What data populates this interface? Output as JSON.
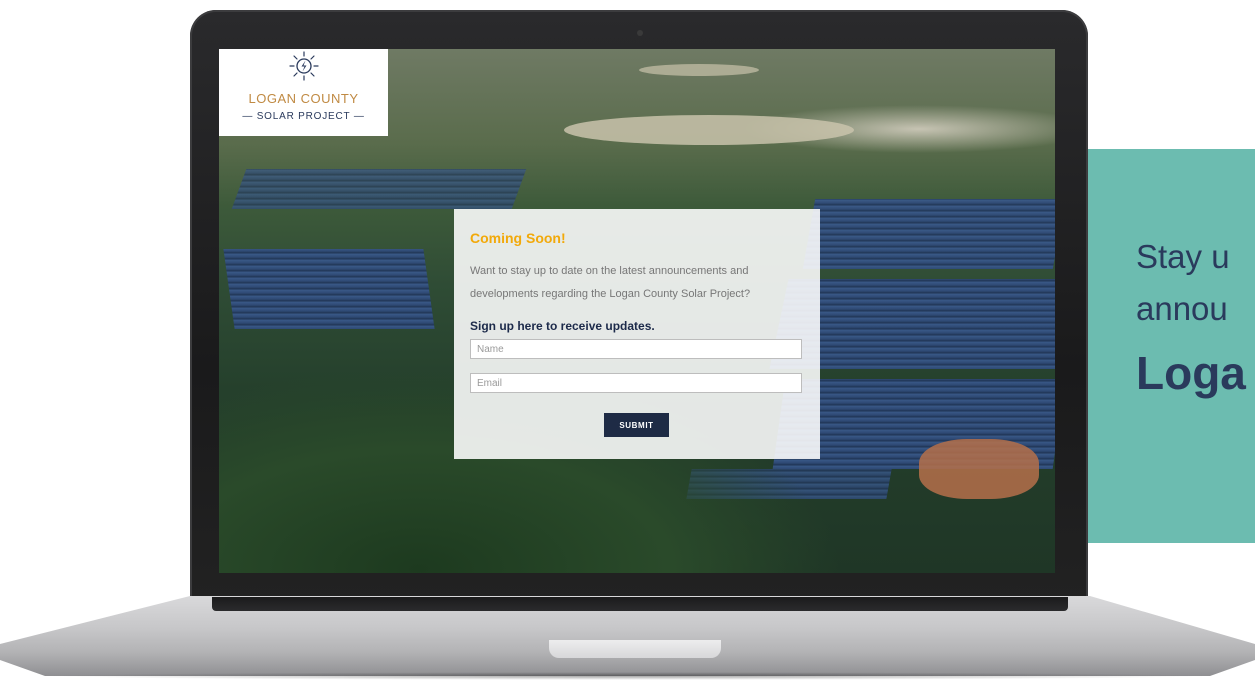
{
  "logo": {
    "icon": "sun-bolt-icon",
    "name": "LOGAN COUNTY",
    "subtitle": "— SOLAR PROJECT —"
  },
  "signup": {
    "title": "Coming Soon!",
    "description": "Want to stay up to date on the latest announcements and developments regarding the Logan County Solar Project?",
    "cta": "Sign up here to receive updates.",
    "name_placeholder": "Name",
    "email_placeholder": "Email",
    "submit_label": "SUBMIT"
  },
  "side_panel": {
    "line1": "Stay u",
    "line2": "annou",
    "line3": "Loga"
  },
  "colors": {
    "accent_orange": "#f2a90a",
    "navy": "#1e2b45",
    "logo_gold": "#c08a43",
    "teal": "#6cbcb0"
  }
}
